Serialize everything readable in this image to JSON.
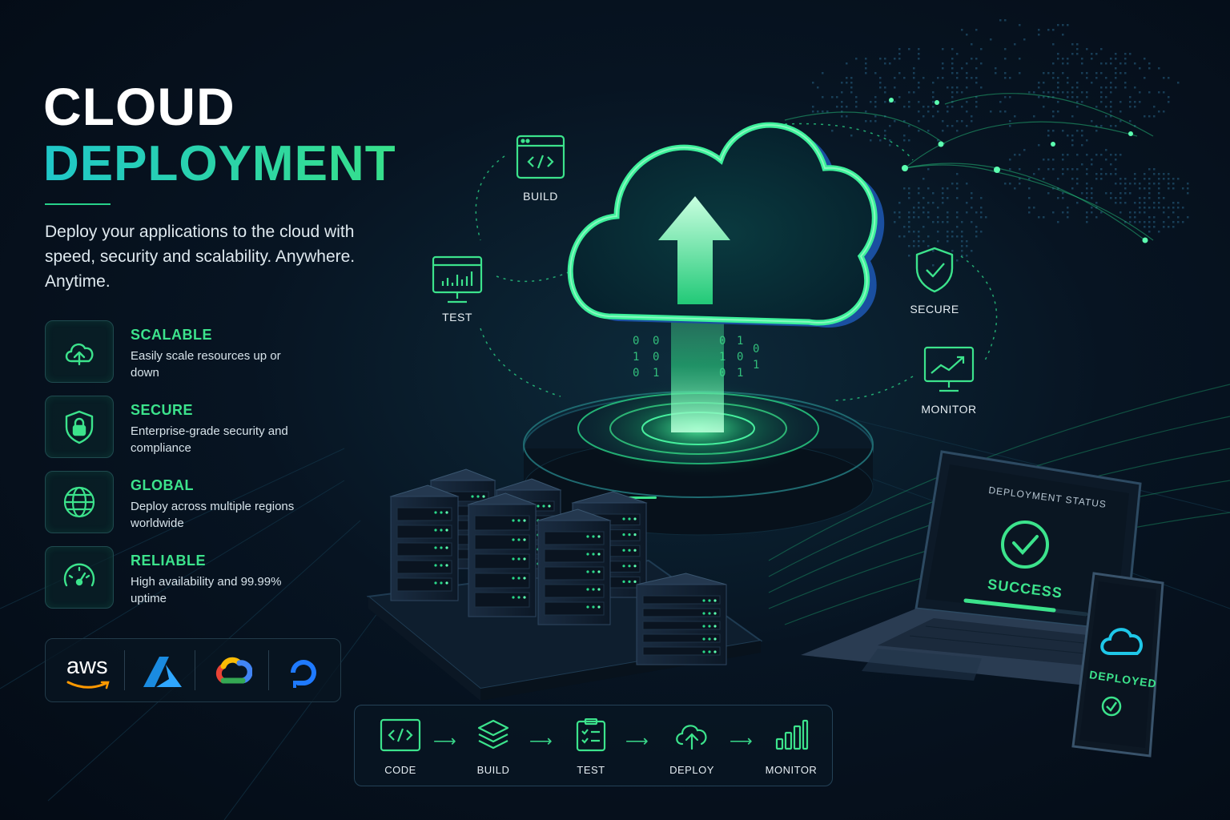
{
  "header": {
    "title_line1": "CLOUD",
    "title_line2": "DEPLOYMENT",
    "tagline": "Deploy your applications to the cloud with speed, security and scalability. Anywhere. Anytime."
  },
  "features": [
    {
      "title": "SCALABLE",
      "desc": "Easily scale resources up or down",
      "icon": "cloud-upload-icon"
    },
    {
      "title": "SECURE",
      "desc": "Enterprise-grade security and compliance",
      "icon": "shield-lock-icon"
    },
    {
      "title": "GLOBAL",
      "desc": "Deploy across multiple regions worldwide",
      "icon": "globe-icon"
    },
    {
      "title": "RELIABLE",
      "desc": "High availability and 99.99% uptime",
      "icon": "gauge-icon"
    }
  ],
  "providers": {
    "aws_label": "aws",
    "items": [
      "aws-logo",
      "azure-logo",
      "google-cloud-logo",
      "digitalocean-logo"
    ]
  },
  "workflow": {
    "build": "BUILD",
    "test": "TEST",
    "secure": "SECURE",
    "monitor": "MONITOR"
  },
  "pipeline": [
    {
      "label": "CODE",
      "icon": "code-icon"
    },
    {
      "label": "BUILD",
      "icon": "layers-icon"
    },
    {
      "label": "TEST",
      "icon": "checklist-icon"
    },
    {
      "label": "DEPLOY",
      "icon": "cloud-upload-icon"
    },
    {
      "label": "MONITOR",
      "icon": "bar-chart-icon"
    }
  ],
  "laptop": {
    "title": "DEPLOYMENT STATUS",
    "status": "SUCCESS"
  },
  "phone": {
    "status": "DEPLOYED"
  },
  "colors": {
    "accent_green": "#3ce38c",
    "accent_teal": "#1fc7c9",
    "background": "#071422"
  }
}
